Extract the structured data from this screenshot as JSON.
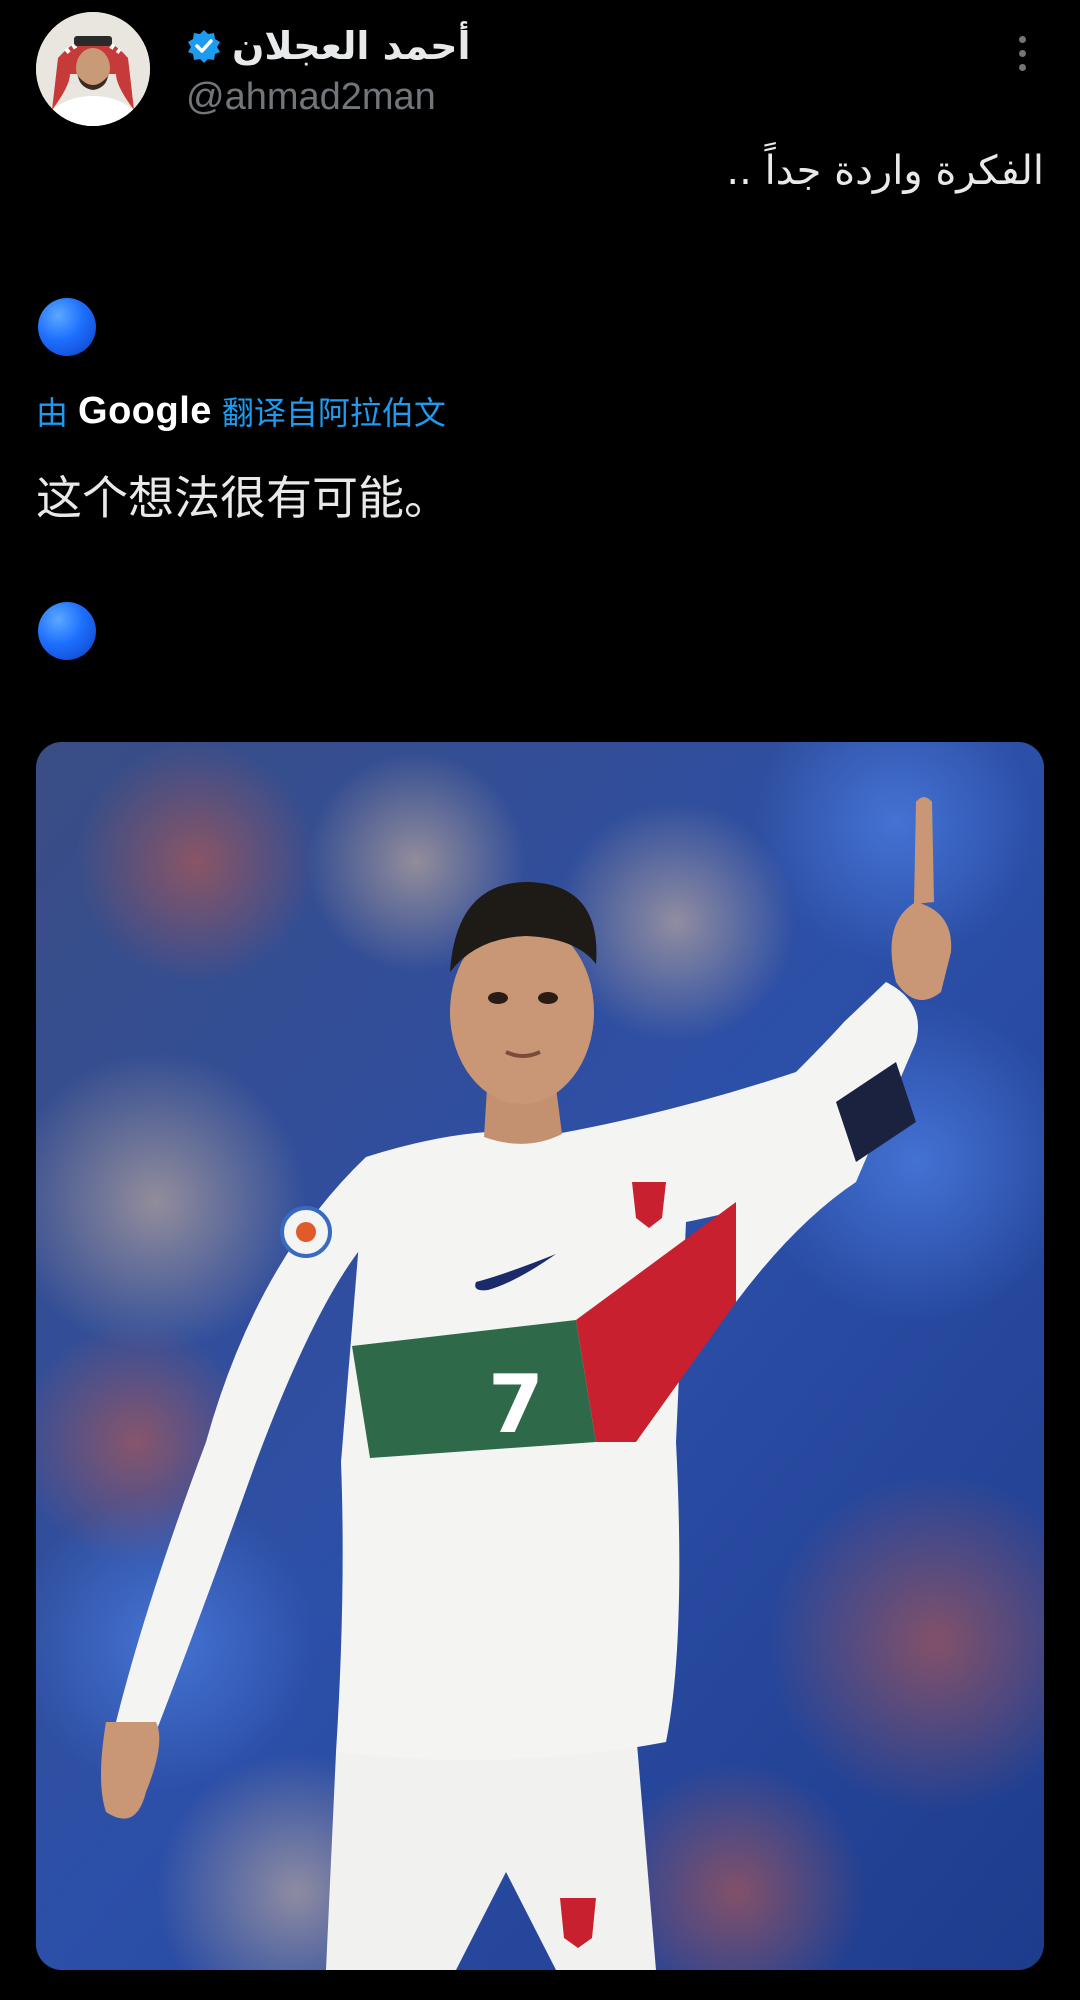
{
  "tweet": {
    "author": {
      "display_name": "أحمد العجلان",
      "handle": "@ahmad2man",
      "verified": true,
      "verified_color": "#1d9bf0"
    },
    "text": "الفكرة واردة جداً ..",
    "translation": {
      "by_label": "由",
      "provider": "Google",
      "from_label": "翻译自阿拉伯文",
      "translated_text": "这个想法很有可能。"
    },
    "emoji_icons": [
      "blue-circle-icon",
      "blue-circle-icon"
    ],
    "media": {
      "type": "photo",
      "jersey_number": "7"
    },
    "more_icon": "more-vertical-icon"
  },
  "colors": {
    "background": "#000000",
    "link": "#1d9bf0",
    "secondary_text": "#71767b",
    "primary_text": "#e7e9ea"
  }
}
